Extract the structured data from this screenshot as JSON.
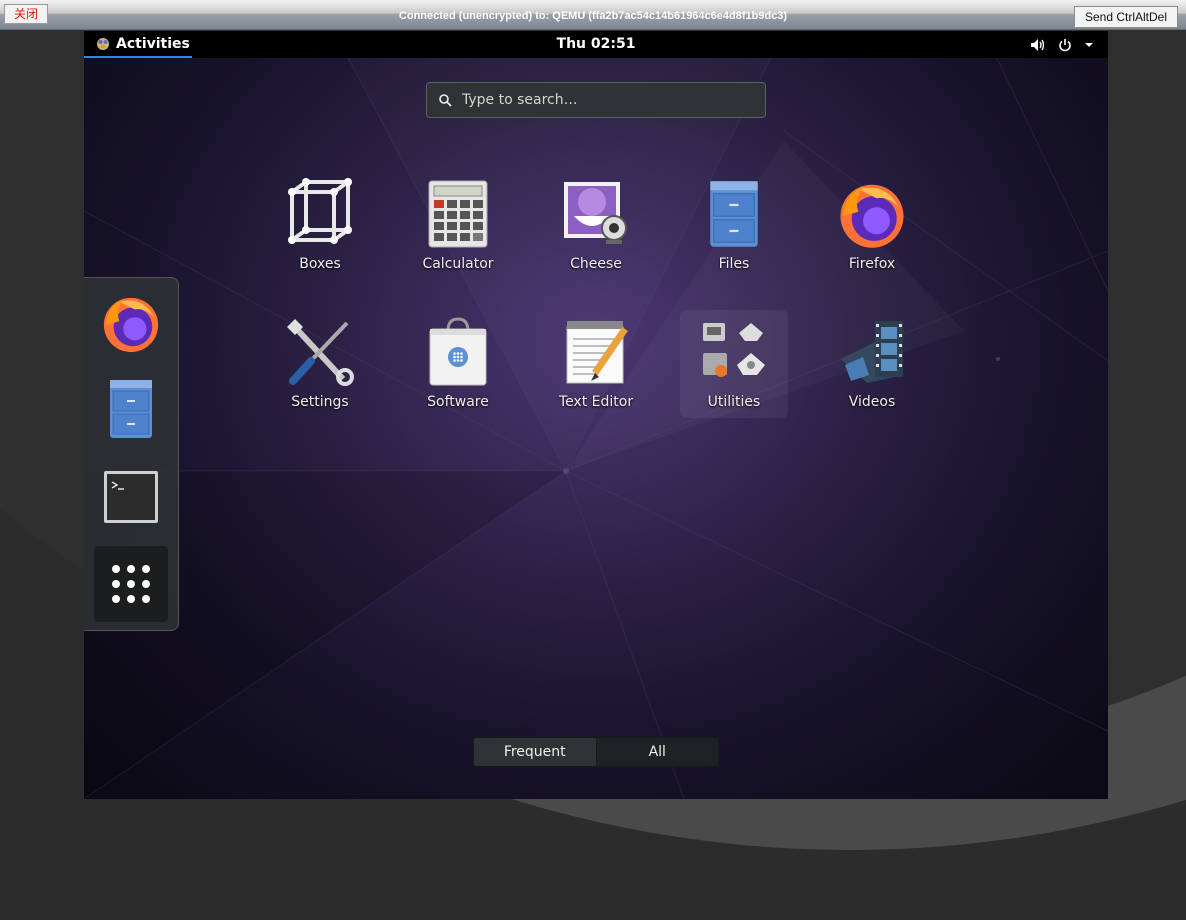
{
  "viewer": {
    "close_label": "关闭",
    "title": "Connected (unencrypted) to: QEMU (ffa2b7ac54c14b61964c6e4d8f1b9dc3)",
    "ctrl_alt_del_label": "Send CtrlAltDel"
  },
  "panel": {
    "activities_label": "Activities",
    "clock": "Thu 02:51"
  },
  "search": {
    "placeholder": "Type to search…"
  },
  "apps": [
    {
      "label": "Boxes"
    },
    {
      "label": "Calculator"
    },
    {
      "label": "Cheese"
    },
    {
      "label": "Files"
    },
    {
      "label": "Firefox"
    },
    {
      "label": "Settings"
    },
    {
      "label": "Software"
    },
    {
      "label": "Text Editor"
    },
    {
      "label": "Utilities"
    },
    {
      "label": "Videos"
    }
  ],
  "view_switch": {
    "frequent_label": "Frequent",
    "all_label": "All"
  },
  "colors": {
    "accent": "#3584e4",
    "panel_bg": "#000000"
  }
}
